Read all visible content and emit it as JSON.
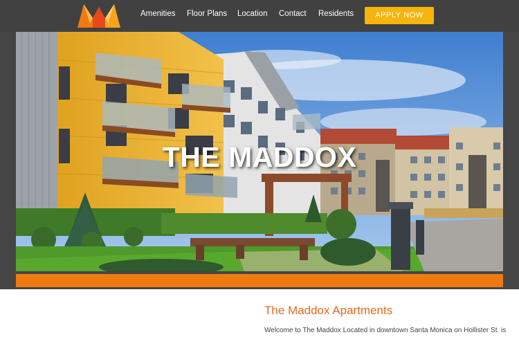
{
  "nav": {
    "logo_name": "maddox-logo",
    "links": [
      "Amenities",
      "Floor Plans",
      "Location",
      "Contact",
      "Residents"
    ],
    "cta_label": "APPLY NOW"
  },
  "hero": {
    "title": "THE MADDOX"
  },
  "content": {
    "title": "The Maddox Apartments",
    "text": "Welcome to The Maddox Located in downtown Santa Monica on Hollister St. is"
  },
  "colors": {
    "nav_bg": "#414141",
    "accent": "#f5b50d",
    "orange": "#f07a12",
    "title_orange": "#e8691a"
  }
}
